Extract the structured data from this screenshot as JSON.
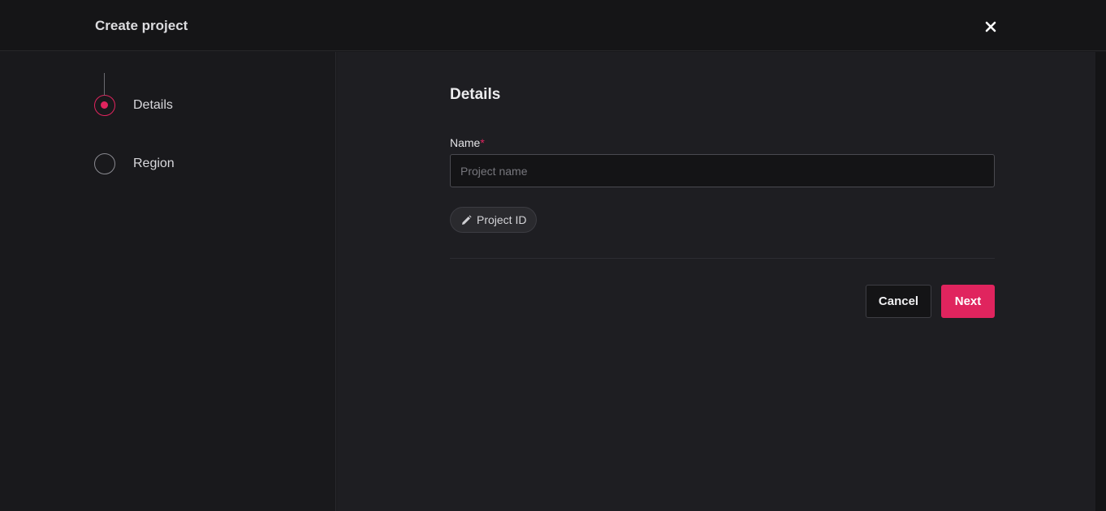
{
  "header": {
    "title": "Create project",
    "close_icon": "close-icon"
  },
  "stepper": {
    "steps": [
      {
        "label": "Details",
        "state": "active"
      },
      {
        "label": "Region",
        "state": "inactive"
      }
    ]
  },
  "form": {
    "section_title": "Details",
    "name_label": "Name",
    "required_mark": "*",
    "name_value": "",
    "name_placeholder": "Project name",
    "project_id_chip": "Project ID",
    "chip_icon": "pencil-icon"
  },
  "actions": {
    "cancel_label": "Cancel",
    "next_label": "Next"
  },
  "colors": {
    "accent": "#e0245e",
    "background": "#1e1e22",
    "sidebar": "#19191c",
    "header": "#151517"
  }
}
